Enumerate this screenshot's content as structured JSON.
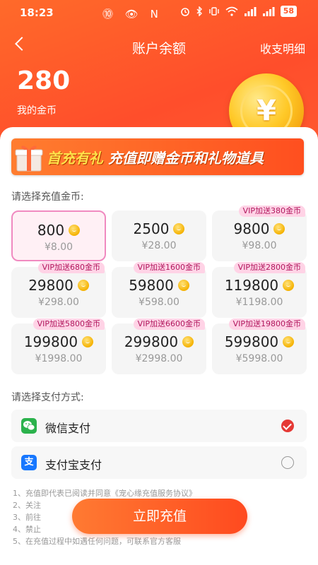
{
  "status_bar": {
    "time": "18:23",
    "left_icons": "⓾ 👁 N",
    "battery": "58"
  },
  "nav": {
    "title": "账户余额",
    "right_link": "收支明细"
  },
  "balance": {
    "amount": "280",
    "label": "我的金币",
    "coin_symbol": "¥"
  },
  "banner": {
    "text_part1": "首充有礼",
    "text_part2": "充值即赠金币和礼物道具"
  },
  "recharge": {
    "label": "请选择充值金币:",
    "packages": [
      {
        "amount": "800",
        "price": "¥8.00",
        "vip": ""
      },
      {
        "amount": "2500",
        "price": "¥28.00",
        "vip": ""
      },
      {
        "amount": "9800",
        "price": "¥98.00",
        "vip": "VIP加送380金币"
      },
      {
        "amount": "29800",
        "price": "¥298.00",
        "vip": "VIP加送680金币"
      },
      {
        "amount": "59800",
        "price": "¥598.00",
        "vip": "VIP加送1600金币"
      },
      {
        "amount": "119800",
        "price": "¥1198.00",
        "vip": "VIP加送2800金币"
      },
      {
        "amount": "199800",
        "price": "¥1998.00",
        "vip": "VIP加送5800金币"
      },
      {
        "amount": "299800",
        "price": "¥2998.00",
        "vip": "VIP加送6600金币"
      },
      {
        "amount": "599800",
        "price": "¥5998.00",
        "vip": "VIP加送19800金币"
      }
    ]
  },
  "payment": {
    "label": "请选择支付方式:",
    "wechat": {
      "label": "微信支付",
      "icon": "wechat-icon"
    },
    "alipay": {
      "label": "支付宝支付",
      "icon": "alipay-icon",
      "icon_char": "支"
    }
  },
  "terms": {
    "line1": "1、充值即代表已阅读并同意《宠心缘充值服务协议》",
    "line2": "2、关注",
    "line3": "3、前往",
    "line4": "4、禁止",
    "line5": "5、在充值过程中如遇任何问题，可联系官方客服"
  },
  "cta": {
    "label": "立即充值"
  },
  "colors": {
    "brand_orange": "#ff5a2d",
    "vip_pink": "#ffd3e6",
    "selected_border": "#f08ac0",
    "check_red": "#e53935",
    "wechat_green": "#2bb24c",
    "alipay_blue": "#1677ff"
  }
}
